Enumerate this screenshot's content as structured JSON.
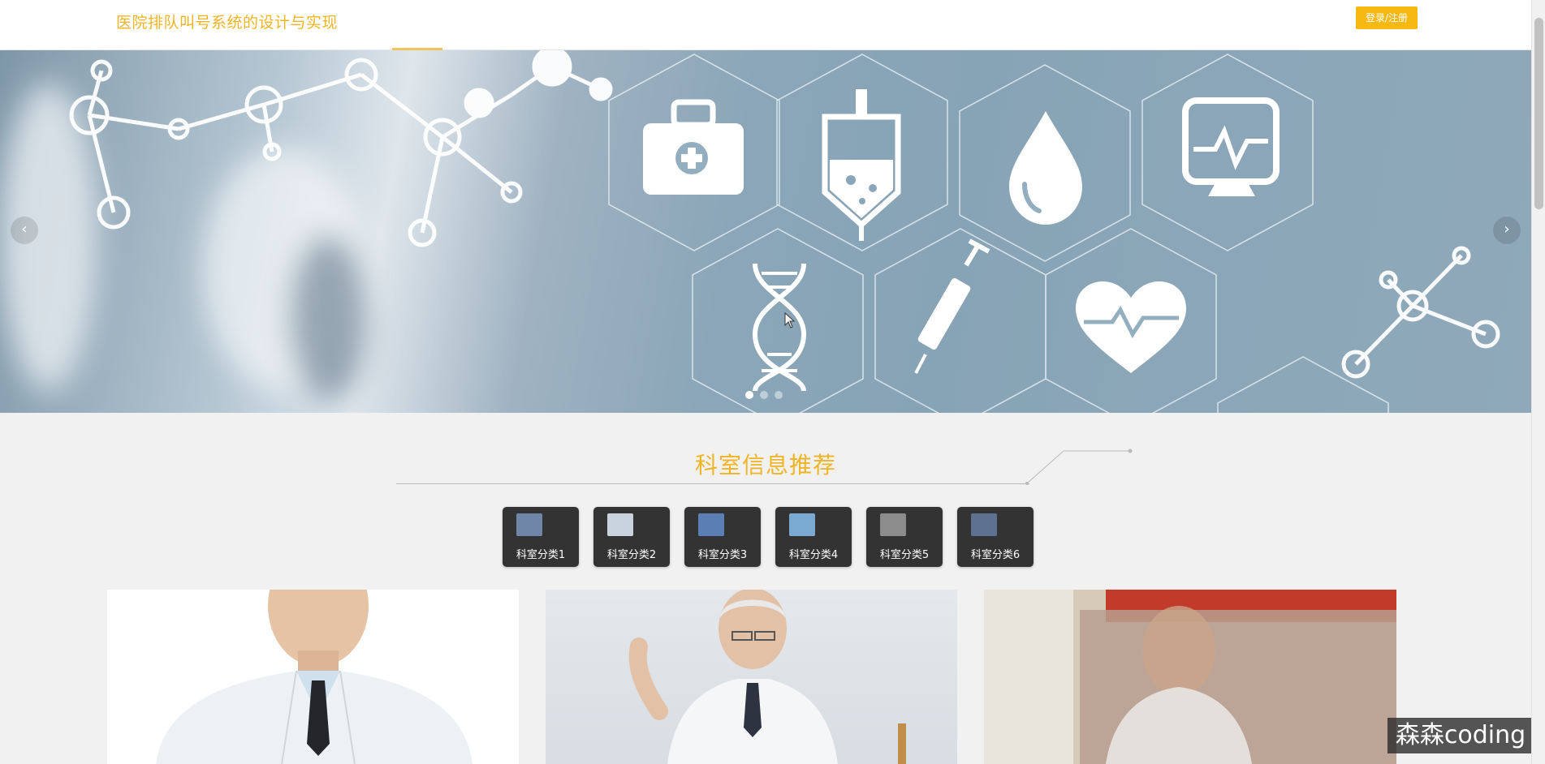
{
  "header": {
    "site_title": "医院排队叫号系统的设计与实现",
    "login_label": "登录/注册"
  },
  "banner": {
    "prev_label": "‹",
    "next_label": "›",
    "slides": 3,
    "active_slide": 1
  },
  "section": {
    "title": "科室信息推荐"
  },
  "categories": [
    {
      "label": "科室分类1",
      "thumb_color": "#6f86a8"
    },
    {
      "label": "科室分类2",
      "thumb_color": "#c9d3dd"
    },
    {
      "label": "科室分类3",
      "thumb_color": "#5b7fb4"
    },
    {
      "label": "科室分类4",
      "thumb_color": "#7aa9d2"
    },
    {
      "label": "科室分类5",
      "thumb_color": "#8c8c8c"
    },
    {
      "label": "科室分类6",
      "thumb_color": "#5f7190"
    }
  ],
  "watermark": "森森coding",
  "colors": {
    "accent": "#f0b424",
    "login_button": "#f7b911",
    "category_tile": "#333333"
  }
}
